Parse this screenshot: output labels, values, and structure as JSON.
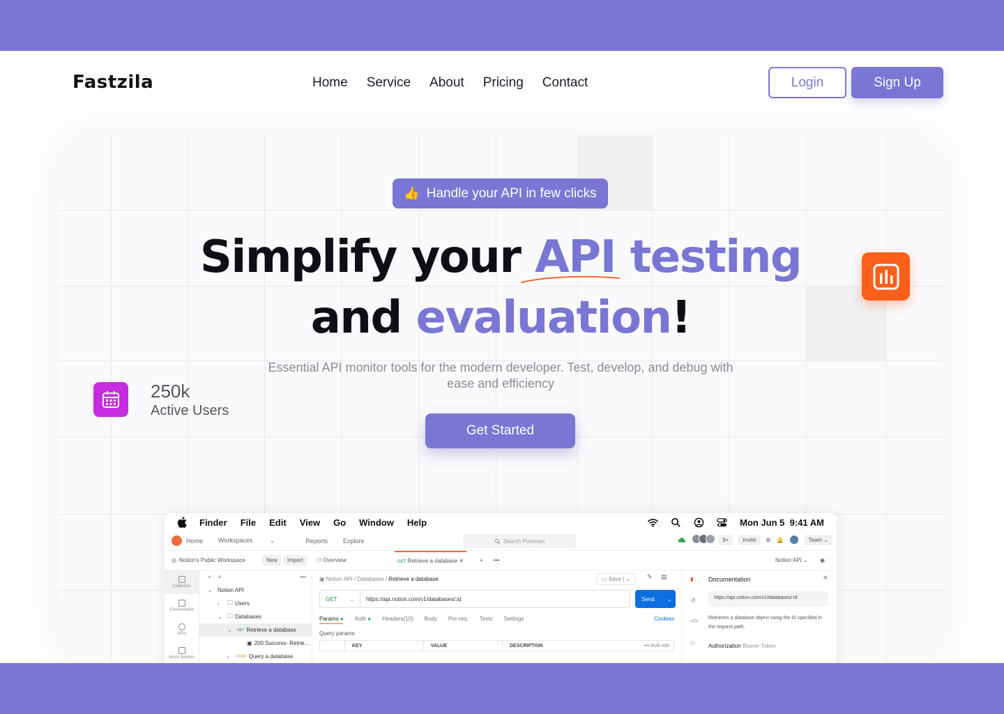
{
  "brand": {
    "name": "Fastzila",
    "accent": "#7a76d4",
    "orange": "#fb5f1a",
    "magenta": "#c62de0"
  },
  "nav": {
    "items": [
      "Home",
      "Service",
      "About",
      "Pricing",
      "Contact"
    ]
  },
  "auth": {
    "login": "Login",
    "signup": "Sign Up"
  },
  "hero": {
    "badge_icon": "thumbs-up-icon",
    "badge_emoji": "👍",
    "badge": "Handle your API in few clicks",
    "title_line1_a": "Simplify your ",
    "title_line1_b": "API testing",
    "title_line2_a": "and ",
    "title_line2_b": "evaluation",
    "title_line2_c": "!",
    "subtitle": "Essential API monitor  tools for the modern developer. Test, develop, and debug with ease and efficiency",
    "cta": "Get Started",
    "stat_value": "250k",
    "stat_label": "Active Users"
  },
  "app": {
    "menubar": {
      "items": [
        "Finder",
        "File",
        "Edit",
        "View",
        "Go",
        "Window",
        "Help"
      ],
      "date": "Mon Jun 5",
      "time": "9:41 AM"
    },
    "postman": {
      "top": [
        "Home",
        "Workspaces",
        "Reports",
        "Explore"
      ],
      "search": "Search Postman",
      "avatar_count": "9+",
      "invite": "Invite",
      "team": "Team",
      "workspace": "Notion's Public Workspace",
      "new": "New",
      "import": "Import",
      "tab_overview": "Overview",
      "tab_active_method": "GET",
      "tab_active": "Retrieve a database",
      "env": "Notion API",
      "rail": [
        "Collection",
        "Environment",
        "APIs",
        "Mock Servers"
      ],
      "tree": [
        {
          "label": "Notion API",
          "indent": 0,
          "caret": "⌄"
        },
        {
          "label": "Users",
          "indent": 1,
          "caret": "›"
        },
        {
          "label": "Databases",
          "indent": 1,
          "caret": "⌄"
        },
        {
          "label": "Retrieve a database",
          "indent": 2,
          "caret": "⌄",
          "method": "GET",
          "selected": true
        },
        {
          "label": "200 Success- Retrie...",
          "indent": 3,
          "caret": ""
        },
        {
          "label": "Query a database",
          "indent": 2,
          "caret": "›",
          "method": "POST"
        }
      ],
      "breadcrumb_prefix": "Notion API / Databases / ",
      "breadcrumb_current": "Retrieve a database",
      "save": "Save",
      "method": "GET",
      "url": "https://api.notion.com/v1/databases/:id",
      "send": "Send",
      "req_tabs": [
        "Params",
        "Auth",
        "Headers(10)",
        "Body",
        "Pre-req.",
        "Tests",
        "Settings"
      ],
      "cookies": "Cookies",
      "query_params": "Query params",
      "columns": [
        "KEY",
        "VALUE",
        "DESCRIPTION"
      ],
      "bulk_edit": "Bulk edit",
      "doc_title": "Documentation",
      "doc_url": "https://api.notion.com/v1/databases/:id",
      "doc_desc": "Retrieves a database object using the ID specified in the request path.",
      "auth_label": "Authorization",
      "auth_value": "Bearer Token"
    }
  }
}
